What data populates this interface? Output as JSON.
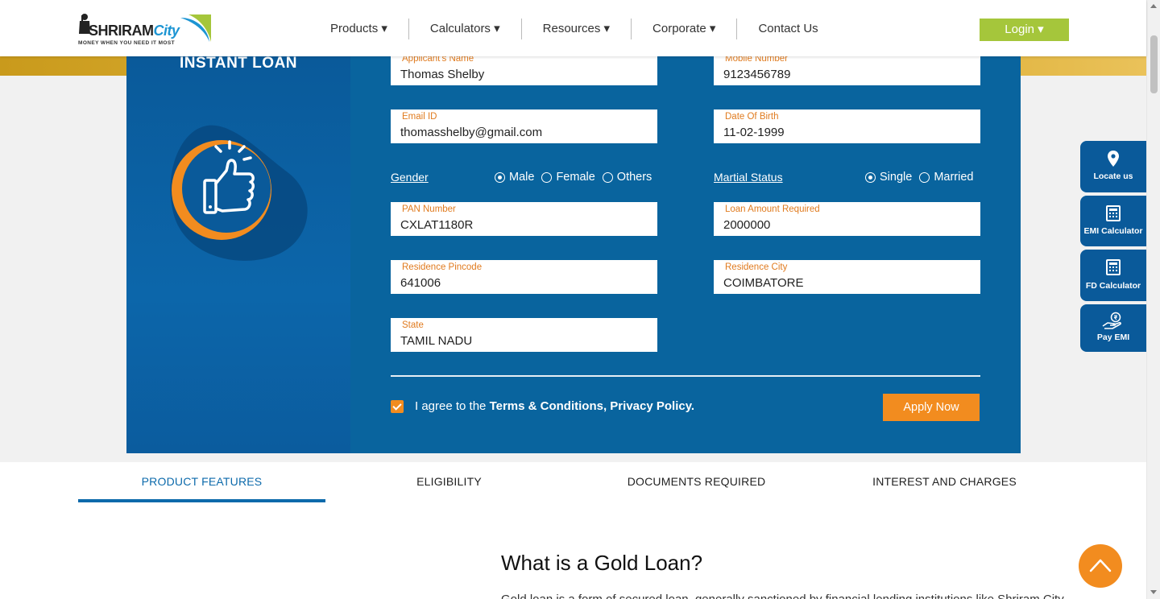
{
  "brand": {
    "name_part1": "SHRIRAM",
    "name_part2": "City",
    "tagline": "MONEY WHEN YOU NEED IT MOST"
  },
  "nav": {
    "items": [
      {
        "label": "Products ▾"
      },
      {
        "label": "Calculators ▾"
      },
      {
        "label": "Resources ▾"
      },
      {
        "label": "Corporate ▾"
      },
      {
        "label": "Contact Us"
      }
    ],
    "login_label": "Login ▾"
  },
  "form": {
    "title": "INSTANT LOAN",
    "fields": {
      "applicant_name": {
        "label": "Applicant's Name",
        "value": "Thomas Shelby"
      },
      "mobile_number": {
        "label": "Mobile Number",
        "value": "9123456789"
      },
      "email": {
        "label": "Email ID",
        "value": "thomasshelby@gmail.com"
      },
      "dob": {
        "label": "Date Of Birth",
        "value": "11-02-1999"
      },
      "pan": {
        "label": "PAN Number",
        "value": "CXLAT1180R"
      },
      "loan_amount": {
        "label": "Loan Amount Required",
        "value": "2000000"
      },
      "pincode": {
        "label": "Residence Pincode",
        "value": "641006"
      },
      "city": {
        "label": "Residence City",
        "value": "COIMBATORE"
      },
      "state": {
        "label": "State",
        "value": "TAMIL NADU"
      }
    },
    "gender": {
      "label": "Gender",
      "options": [
        "Male",
        "Female",
        "Others"
      ],
      "selected": "Male"
    },
    "marital": {
      "label": "Martial Status",
      "options": [
        "Single",
        "Married"
      ],
      "selected": "Single"
    },
    "agree_prefix": "I agree to the",
    "agree_terms": "Terms & Conditions, Privacy Policy.",
    "agree_checked": true,
    "apply_label": "Apply Now"
  },
  "side_widgets": [
    {
      "label": "Locate us",
      "icon": "location-pin-icon"
    },
    {
      "label": "EMI Calculator",
      "icon": "calculator-icon"
    },
    {
      "label": "FD Calculator",
      "icon": "calculator-icon"
    },
    {
      "label": "Pay EMI",
      "icon": "hand-coin-icon"
    }
  ],
  "tabs": [
    {
      "label": "PRODUCT FEATURES",
      "active": true
    },
    {
      "label": "ELIGIBILITY",
      "active": false
    },
    {
      "label": "DOCUMENTS REQUIRED",
      "active": false
    },
    {
      "label": "INTEREST AND CHARGES",
      "active": false
    }
  ],
  "content": {
    "heading": "What is a Gold Loan?",
    "paragraph": "Gold loan is a form of secured loan, generally sanctioned by financial lending institutions like Shriram City"
  },
  "colors": {
    "primary_blue": "#09649e",
    "accent_orange": "#f28c1f",
    "login_green": "#a5c63b"
  }
}
